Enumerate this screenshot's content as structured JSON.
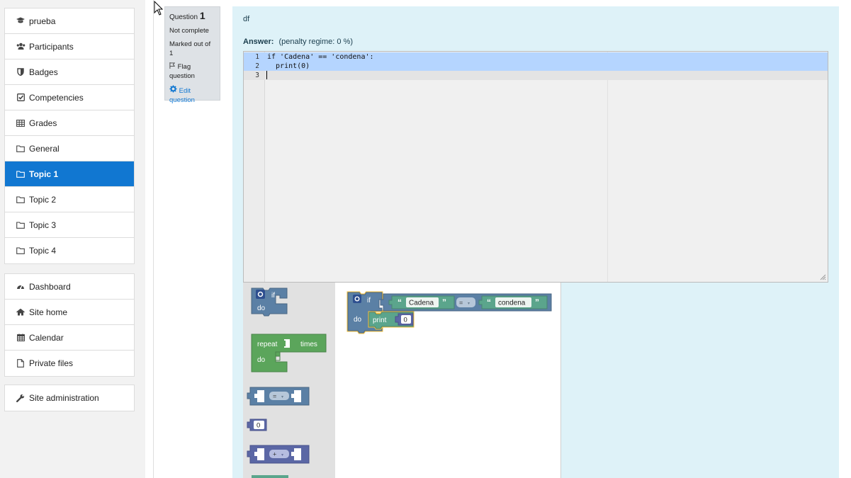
{
  "nav_course": [
    {
      "label": "prueba",
      "icon": "graduation-cap-icon"
    },
    {
      "label": "Participants",
      "icon": "users-icon"
    },
    {
      "label": "Badges",
      "icon": "shield-icon"
    },
    {
      "label": "Competencies",
      "icon": "check-square-icon"
    },
    {
      "label": "Grades",
      "icon": "table-icon"
    },
    {
      "label": "General",
      "icon": "folder-icon"
    },
    {
      "label": "Topic 1",
      "icon": "folder-icon",
      "active": true
    },
    {
      "label": "Topic 2",
      "icon": "folder-icon"
    },
    {
      "label": "Topic 3",
      "icon": "folder-icon"
    },
    {
      "label": "Topic 4",
      "icon": "folder-icon"
    }
  ],
  "nav_site": [
    {
      "label": "Dashboard",
      "icon": "dashboard-icon"
    },
    {
      "label": "Site home",
      "icon": "home-icon"
    },
    {
      "label": "Calendar",
      "icon": "calendar-icon"
    },
    {
      "label": "Private files",
      "icon": "file-icon"
    }
  ],
  "nav_admin": [
    {
      "label": "Site administration",
      "icon": "wrench-icon"
    }
  ],
  "question_info": {
    "label": "Question",
    "number": "1",
    "state": "Not complete",
    "marks": "Marked out of 1",
    "flag_line1": "Flag",
    "flag_line2": "question",
    "edit_line1": "Edit",
    "edit_line2": "question"
  },
  "question": {
    "text": "df",
    "answer_label": "Answer:",
    "penalty": "(penalty regime: 0 %)"
  },
  "editor": {
    "lines": [
      {
        "num": "1",
        "code": "if 'Cadena' == 'condena':"
      },
      {
        "num": "2",
        "code": "  print(0)"
      },
      {
        "num": "3",
        "code": ""
      }
    ]
  },
  "toolbox": {
    "if_label": "if",
    "do_label": "do",
    "repeat_label": "repeat",
    "times_label": "times",
    "repeat_do_label": "do",
    "compare_op": "=",
    "number_value": "0",
    "arith_op": "+"
  },
  "workspace": {
    "if_label": "if",
    "do_label": "do",
    "left_string": "Cadena",
    "operator": "=",
    "right_string": "condena",
    "print_label": "print",
    "print_value": "0"
  },
  "colors": {
    "accent": "#1177d1",
    "logic_block": "#5b80a5",
    "loop_block": "#5ba55b",
    "math_block": "#5b67a5",
    "text_block": "#5ba58c",
    "selection": "#b5d5ff"
  }
}
